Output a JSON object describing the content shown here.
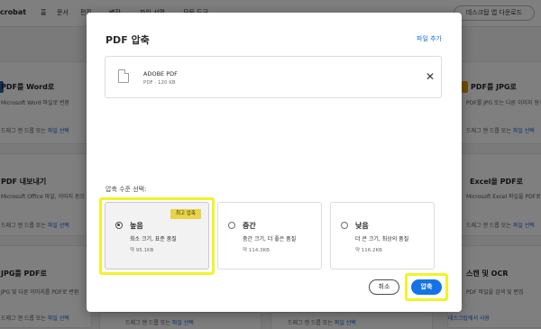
{
  "app": {
    "brand": "crobat",
    "nav": [
      "홈",
      "문서",
      "편집",
      "변환",
      "파일 서명",
      "모든 도구"
    ],
    "download_button": "데스크탑 앱 다운로드"
  },
  "tool_cards": [
    {
      "title": "PDF를 Word로",
      "desc": "Microsoft Word 파일로 변환",
      "drop_prefix": "드래그 앤 드롭 또는",
      "drop_link": "파일 선택",
      "icon_color": "#2b5fb4"
    },
    {
      "title": "PDF 내보내기",
      "desc": "Microsoft Office 파일, 이미지 등으",
      "drop_prefix": "드래그 앤 드롭 또는",
      "drop_link": "파일 선택",
      "icon_color": "#e34850"
    },
    {
      "title": "JPG를 PDF로",
      "desc": "JPG 및 다른 이미지를 PDF로 변환",
      "drop_prefix": "드래그 앤 드롭 또는",
      "drop_link": "파일 선택",
      "icon_color": "#e3a000"
    },
    {
      "title": "PDF를 JPG로",
      "desc": "PDF를 JPG 또는 다른 이미지 형식",
      "drop_prefix": "드래그 앤 드롭 또는",
      "drop_link": "파일 선택",
      "icon_color": "#e3a000"
    },
    {
      "title": "Excel을 PDF로",
      "desc": "Microsoft Excel 파일을 PDF로 변",
      "drop_prefix": "드래그 앤 드롭 또는",
      "drop_link": "파일 선택",
      "icon_color": "#1f8a4c"
    },
    {
      "title": "스캔 및 OCR",
      "desc": "PDF 파일을 검색 및 편집",
      "drop_prefix": "",
      "drop_link": "데스크탑에서 사용",
      "icon_color": "#e34850"
    },
    {
      "title": "",
      "desc": "",
      "drop_prefix": "드래그 앤 드롭 또는",
      "drop_link": "파일 선택",
      "icon_color": "#e34850"
    },
    {
      "title": "",
      "desc": "",
      "drop_prefix": "드래그 앤 드롭 또는",
      "drop_link": "파일 선택",
      "icon_color": "#e34850"
    }
  ],
  "dialog": {
    "title": "PDF 압축",
    "add_file": "파일 추가",
    "file": {
      "name": "ADOBE PDF",
      "meta": "PDF · 120 KB"
    },
    "level_label": "압축 수준 선택:",
    "options": [
      {
        "title": "높음",
        "desc": "최소 크기, 표준 품질",
        "size": "약 95.1KB",
        "badge": "최고 압축",
        "selected": true
      },
      {
        "title": "중간",
        "desc": "중간 크기, 더 좋은 품질",
        "size": "약 114.3KB",
        "selected": false
      },
      {
        "title": "낮음",
        "desc": "더 큰 크기, 최상의 품질",
        "size": "약 116.2KB",
        "selected": false
      }
    ],
    "cancel": "취소",
    "compress": "압축"
  },
  "colors": {
    "accent": "#1473e6",
    "highlight": "#f2f22a",
    "badge": "#e8d34a"
  }
}
